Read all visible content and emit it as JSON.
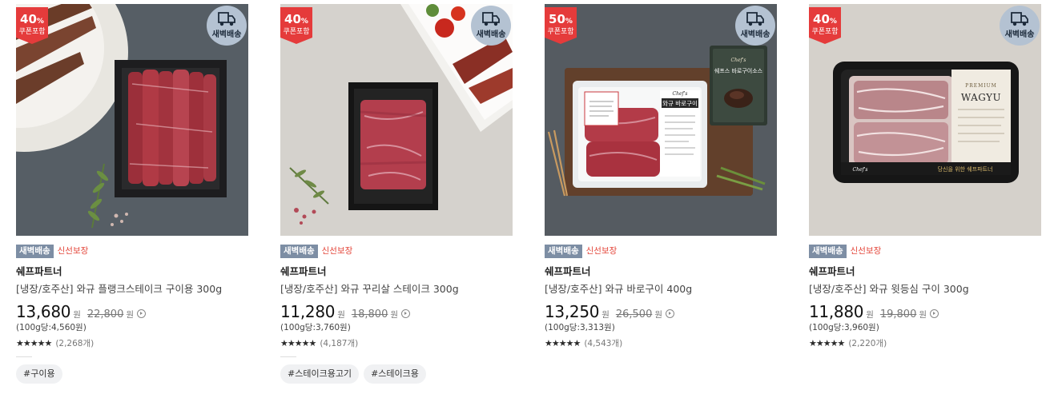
{
  "products": [
    {
      "coupon": {
        "percent": "40",
        "percent_sign": "%",
        "label": "쿠폰포함"
      },
      "dawn_badge": "새벽배송",
      "tags": {
        "delivery": "새벽배송",
        "fresh": "신선보장"
      },
      "brand": "쉐프파트너",
      "name": "[냉장/호주산] 와규 플랭크스테이크 구이용 300g",
      "price": "13,680",
      "price_unit": "원",
      "original_price": "22,800",
      "original_unit": "원",
      "unit_price": "(100g당:4,560원)",
      "stars": "★★★★★",
      "review_count": "(2,268개)",
      "hashtags": [
        "#구이용"
      ]
    },
    {
      "coupon": {
        "percent": "40",
        "percent_sign": "%",
        "label": "쿠폰포함"
      },
      "dawn_badge": "새벽배송",
      "tags": {
        "delivery": "새벽배송",
        "fresh": "신선보장"
      },
      "brand": "쉐프파트너",
      "name": "[냉장/호주산] 와규 꾸리살 스테이크 300g",
      "price": "11,280",
      "price_unit": "원",
      "original_price": "18,800",
      "original_unit": "원",
      "unit_price": "(100g당:3,760원)",
      "stars": "★★★★★",
      "review_count": "(4,187개)",
      "hashtags": [
        "#스테이크용고기",
        "#스테이크용"
      ]
    },
    {
      "coupon": {
        "percent": "50",
        "percent_sign": "%",
        "label": "쿠폰포함"
      },
      "dawn_badge": "새벽배송",
      "tags": {
        "delivery": "새벽배송",
        "fresh": "신선보장"
      },
      "brand": "쉐프파트너",
      "name": "[냉장/호주산] 와규 바로구이 400g",
      "price": "13,250",
      "price_unit": "원",
      "original_price": "26,500",
      "original_unit": "원",
      "unit_price": "(100g당:3,313원)",
      "stars": "★★★★★",
      "review_count": "(4,543개)",
      "package_text": {
        "brand": "Chef's",
        "label": "와규 바로구이",
        "sauce": "쉐프스 바로구이소스"
      },
      "hashtags": []
    },
    {
      "coupon": {
        "percent": "40",
        "percent_sign": "%",
        "label": "쿠폰포함"
      },
      "dawn_badge": "새벽배송",
      "tags": {
        "delivery": "새벽배송",
        "fresh": "신선보장"
      },
      "brand": "쉐프파트너",
      "name": "[냉장/호주산] 와규 윗등심 구이 300g",
      "price": "11,880",
      "price_unit": "원",
      "original_price": "19,800",
      "original_unit": "원",
      "unit_price": "(100g당:3,960원)",
      "stars": "★★★★★",
      "review_count": "(2,220개)",
      "package_text": {
        "wagyu": "WAGYU",
        "premium": "PREMIUM",
        "brand": "Chef's",
        "slogan": "당신을 위한 쉐프파트너"
      },
      "hashtags": []
    }
  ],
  "colors": {
    "coupon_red": "#e53b3b",
    "dawn_circle": "#b4c2d2",
    "dawn_tag": "#7d8ea4",
    "fresh_text": "#e4463a"
  },
  "icons": {
    "dawn_badge": "delivery-truck-icon",
    "info": "info-circle-icon",
    "rating": "star-icon"
  }
}
